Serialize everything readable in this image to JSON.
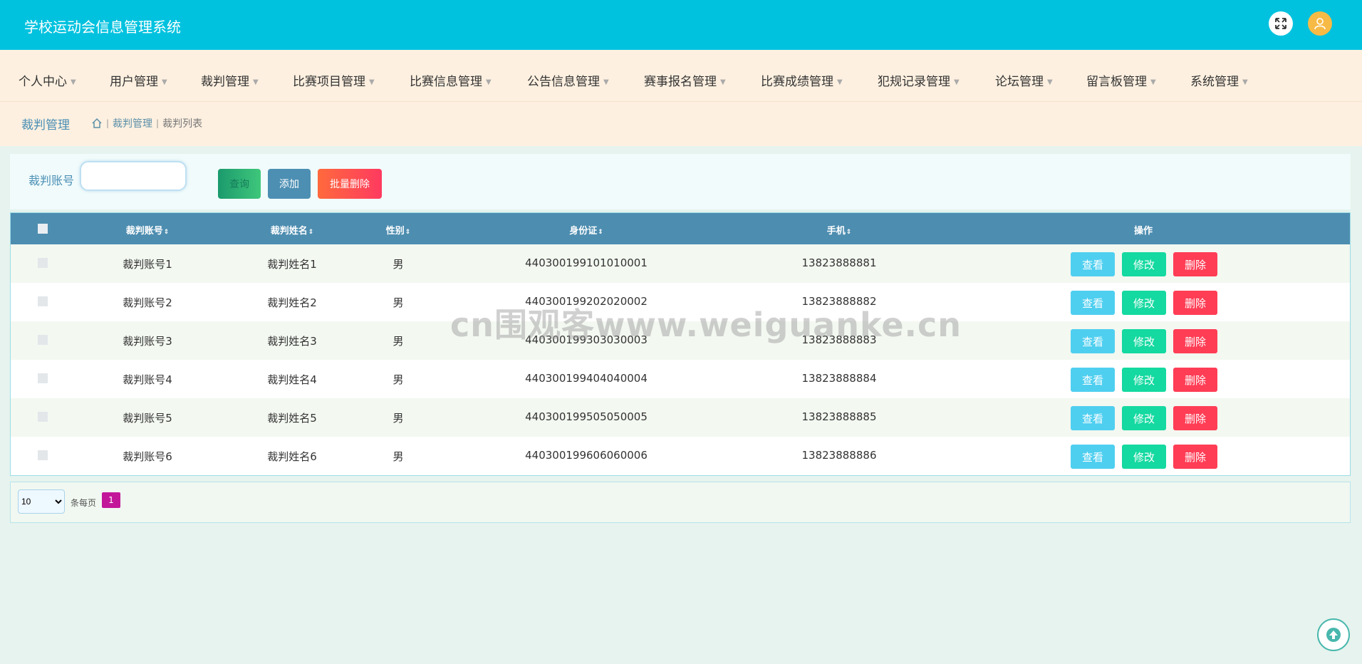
{
  "app": {
    "title": "学校运动会信息管理系统"
  },
  "nav": {
    "items": [
      {
        "label": "个人中心"
      },
      {
        "label": "用户管理"
      },
      {
        "label": "裁判管理"
      },
      {
        "label": "比赛项目管理"
      },
      {
        "label": "比赛信息管理"
      },
      {
        "label": "公告信息管理"
      },
      {
        "label": "赛事报名管理"
      },
      {
        "label": "比赛成绩管理"
      },
      {
        "label": "犯规记录管理"
      },
      {
        "label": "论坛管理"
      },
      {
        "label": "留言板管理"
      },
      {
        "label": "系统管理"
      }
    ]
  },
  "breadcrumb": {
    "title": "裁判管理",
    "path1": "裁判管理",
    "path2": "裁判列表"
  },
  "search": {
    "label": "裁判账号",
    "value": "",
    "query_label": "查询",
    "add_label": "添加",
    "batch_delete_label": "批量删除"
  },
  "table": {
    "headers": [
      "裁判账号",
      "裁判姓名",
      "性别",
      "身份证",
      "手机",
      "操作"
    ],
    "rows": [
      {
        "account": "裁判账号1",
        "name": "裁判姓名1",
        "gender": "男",
        "idcard": "440300199101010001",
        "phone": "13823888881"
      },
      {
        "account": "裁判账号2",
        "name": "裁判姓名2",
        "gender": "男",
        "idcard": "440300199202020002",
        "phone": "13823888882"
      },
      {
        "account": "裁判账号3",
        "name": "裁判姓名3",
        "gender": "男",
        "idcard": "440300199303030003",
        "phone": "13823888883"
      },
      {
        "account": "裁判账号4",
        "name": "裁判姓名4",
        "gender": "男",
        "idcard": "440300199404040004",
        "phone": "13823888884"
      },
      {
        "account": "裁判账号5",
        "name": "裁判姓名5",
        "gender": "男",
        "idcard": "440300199505050005",
        "phone": "13823888885"
      },
      {
        "account": "裁判账号6",
        "name": "裁判姓名6",
        "gender": "男",
        "idcard": "440300199606060006",
        "phone": "13823888886"
      }
    ],
    "actions": {
      "view": "查看",
      "edit": "修改",
      "delete": "删除"
    }
  },
  "pager": {
    "per_page": "10",
    "per_page_label": "条每页",
    "current_page": "1"
  },
  "watermark": "cn围观客www.weiguanke.cn",
  "colors": {
    "topbar": "#00c2df",
    "nav_bg": "#fdf0e0",
    "table_header": "#4d8db0",
    "page_active": "#c3179a"
  },
  "icons": {
    "fullscreen": "expand-icon",
    "user": "user-icon",
    "home": "home-icon",
    "back_top": "arrow-up-icon"
  }
}
